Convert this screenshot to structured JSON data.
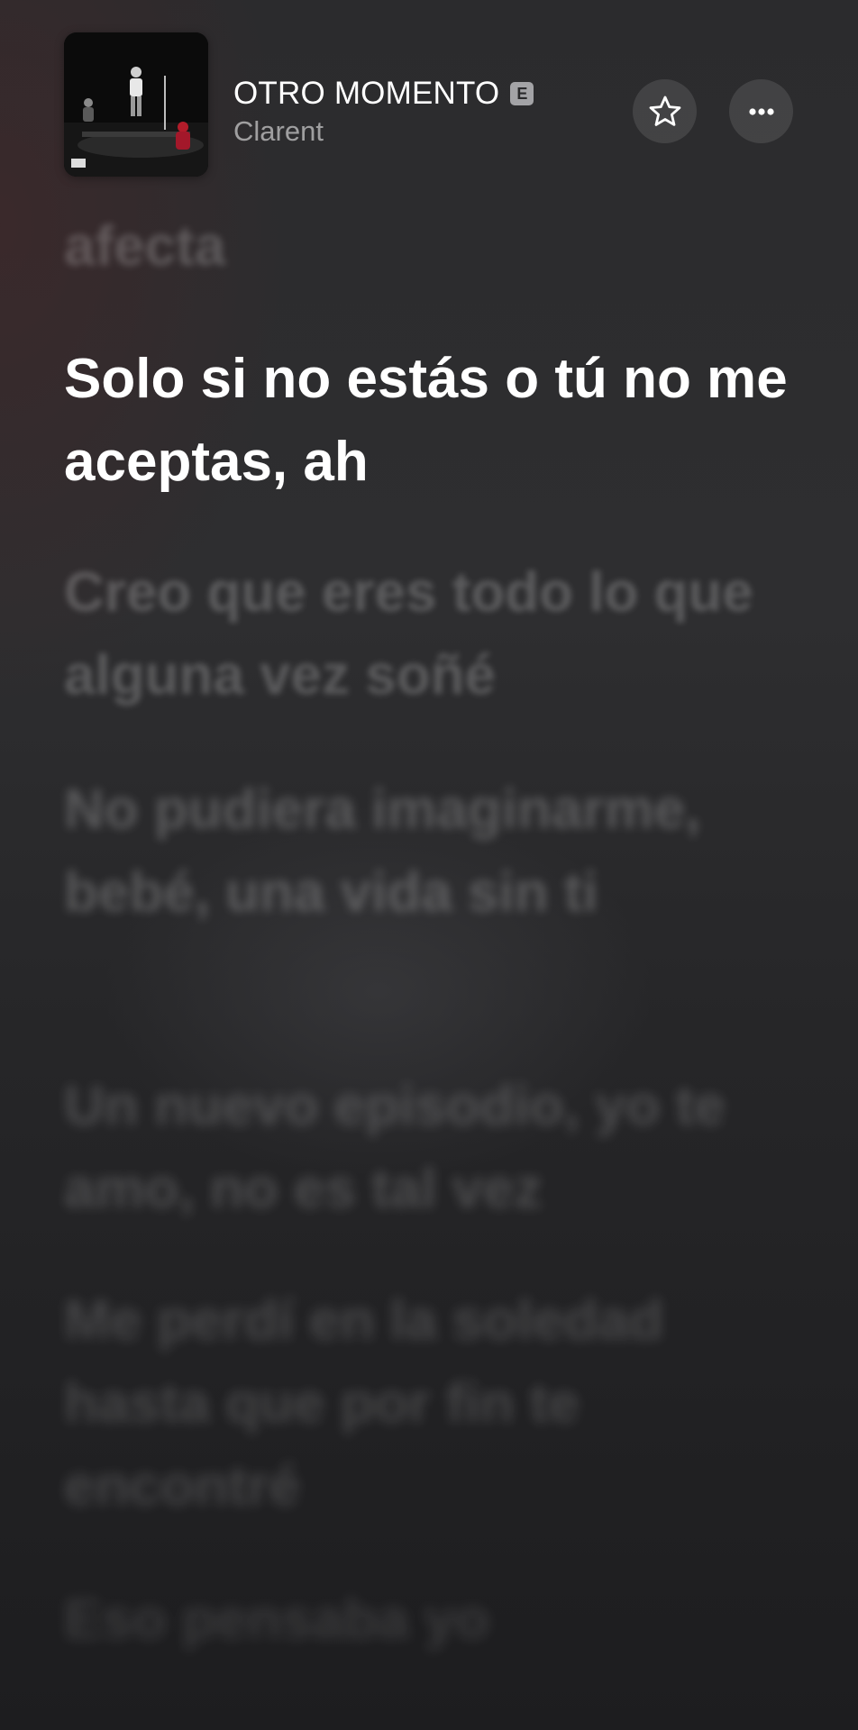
{
  "now_playing": {
    "title": "OTRO MOMENTO",
    "explicit_badge": "E",
    "artist": "Clarent",
    "artwork_icon": "album-artwork",
    "favorite_icon": "star-icon",
    "more_icon": "ellipsis-icon"
  },
  "lyrics": {
    "previous_line": "afecta",
    "active_line": "Solo si no estás o tú no me aceptas, ah",
    "upcoming": [
      "Creo que eres todo lo que alguna vez soñé",
      "No pudiera imaginarme, bebé, una vida sin ti",
      "Un nuevo episodio, yo te amo, no es tal vez",
      "Me perdí en la soledad hasta que por fin te encontré",
      "Eso pensaba yo"
    ]
  },
  "colors": {
    "background": "#2b2b2d",
    "active_text": "#ffffff",
    "dim_text": "rgba(255,255,255,0.22)",
    "button_bg": "rgba(255,255,255,0.11)"
  }
}
